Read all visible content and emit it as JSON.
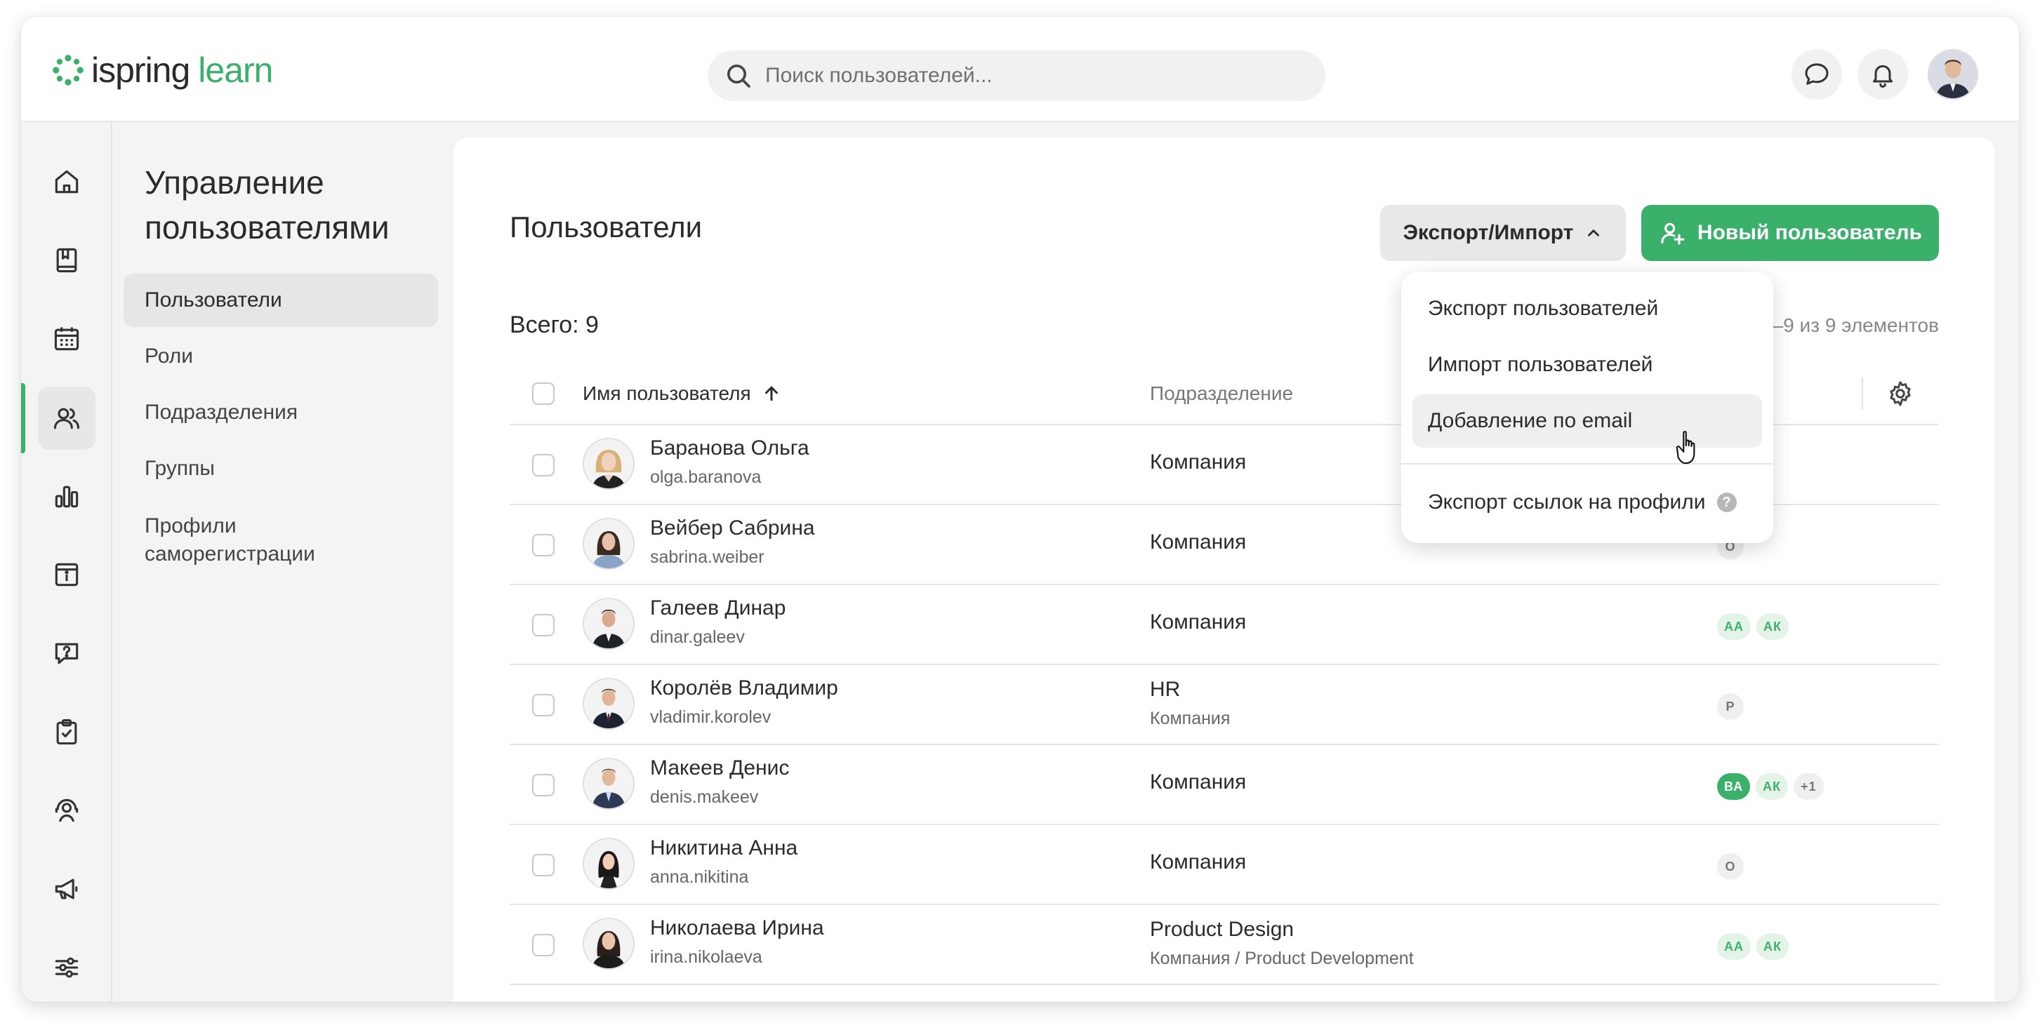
{
  "app": {
    "brand_part1": "ispring",
    "brand_part2": "learn",
    "accent_color": "#3bb06a"
  },
  "header": {
    "search_placeholder": "Поиск пользователей...",
    "icons": [
      "search-icon",
      "chat-icon",
      "bell-icon",
      "avatar"
    ]
  },
  "rail": {
    "items": [
      "home-icon",
      "book-icon",
      "calendar-icon",
      "users-icon",
      "bar-chart-icon",
      "info-board-icon",
      "question-icon",
      "clipboard-check-icon",
      "headset-icon",
      "megaphone-icon",
      "sliders-icon"
    ],
    "active": "users-icon"
  },
  "sidebar": {
    "title_line1": "Управление",
    "title_line2": "пользователями",
    "items": [
      {
        "label": "Пользователи",
        "active": true
      },
      {
        "label": "Роли"
      },
      {
        "label": "Подразделения"
      },
      {
        "label": "Группы"
      },
      {
        "label_line1": "Профили",
        "label_line2": "саморегистрации"
      }
    ]
  },
  "main": {
    "title": "Пользователи",
    "export_import_label": "Экспорт/Импорт",
    "new_user_label": "Новый пользователь",
    "total_label": "Всего: 9",
    "pager_label": "1–9 из 9 элементов",
    "columns": {
      "name": "Имя пользователя",
      "department": "Подразделение"
    },
    "rows": [
      {
        "name": "Баранова Ольга",
        "login": "olga.baranova",
        "department": "Компания",
        "badges": []
      },
      {
        "name": "Вейбер Сабрина",
        "login": "sabrina.weiber",
        "department": "Компания",
        "badges": [
          "О"
        ]
      },
      {
        "name": "Галеев Динар",
        "login": "dinar.galeev",
        "department": "Компания",
        "badges": [
          "АА",
          "АК"
        ]
      },
      {
        "name": "Королёв Владимир",
        "login": "vladimir.korolev",
        "department": "HR",
        "department_sub": "Компания",
        "badges": [
          "Р"
        ]
      },
      {
        "name": "Макеев Денис",
        "login": "denis.makeev",
        "department": "Компания",
        "badges": [
          "ВА",
          "АК",
          "+1"
        ]
      },
      {
        "name": "Никитина Анна",
        "login": "anna.nikitina",
        "department": "Компания",
        "badges": [
          "О"
        ]
      },
      {
        "name": "Николаева Ирина",
        "login": "irina.nikolaeva",
        "department": "Product Design",
        "department_sub": "Компания / Product Development",
        "badges": [
          "АА",
          "АК"
        ]
      }
    ]
  },
  "dropdown": {
    "items": [
      "Экспорт пользователей",
      "Импорт пользователей",
      "Добавление по email",
      "Экспорт ссылок на профили"
    ],
    "hovered": "Добавление по email",
    "help_glyph": "?"
  }
}
